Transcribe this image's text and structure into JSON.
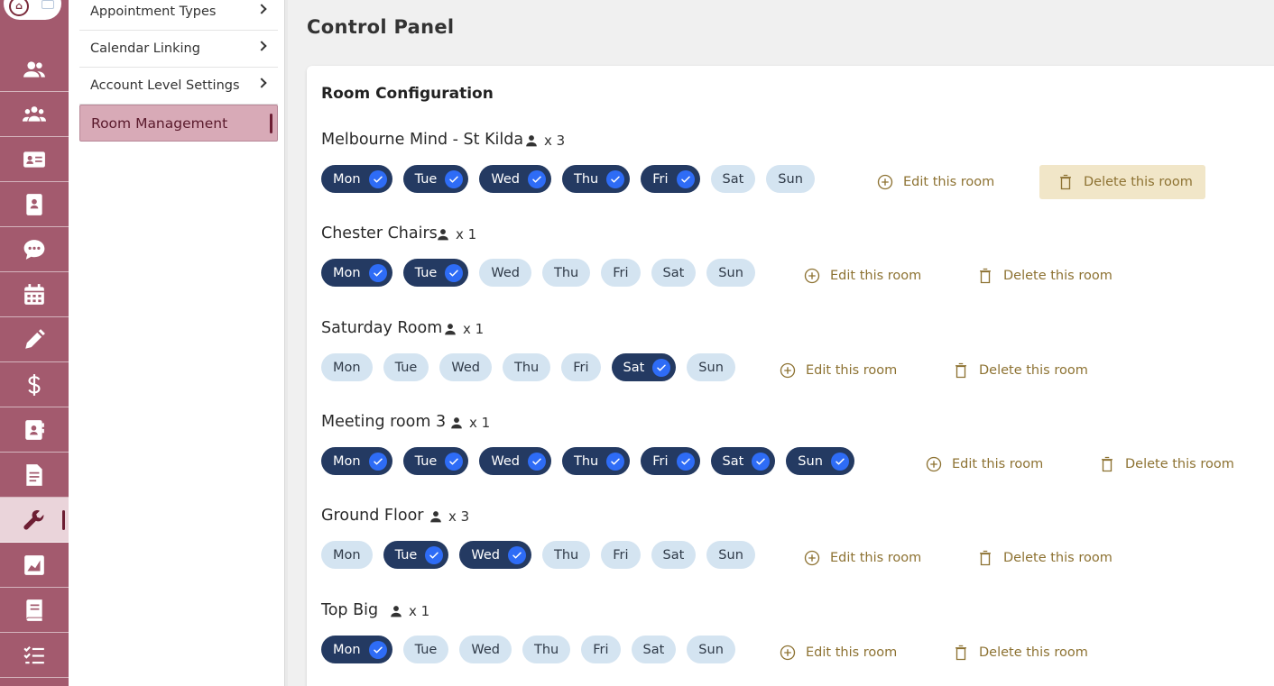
{
  "submenu": {
    "items": [
      {
        "label": "Appointment Types"
      },
      {
        "label": "Calendar Linking"
      },
      {
        "label": "Account Level Settings"
      },
      {
        "label": "Room Management"
      }
    ]
  },
  "rail": {
    "icons": [
      "person-icon",
      "group-icon",
      "id-card-icon",
      "contact-book-icon",
      "chat-icon",
      "calendar-icon",
      "pencil-icon",
      "dollar-icon",
      "address-book-icon",
      "document-icon",
      "wrench-icon",
      "chart-icon",
      "book-icon",
      "checklist-icon"
    ],
    "active": "wrench-icon"
  },
  "page": {
    "title": "Control Panel"
  },
  "room_config": {
    "title": "Room Configuration",
    "edit_label": "Edit this room",
    "delete_label": "Delete this room",
    "rooms": [
      {
        "name": "Melbourne Mind - St Kilda",
        "capacity": "x 3",
        "days": [
          {
            "label": "Mon",
            "on": true
          },
          {
            "label": "Tue",
            "on": true
          },
          {
            "label": "Wed",
            "on": true
          },
          {
            "label": "Thu",
            "on": true
          },
          {
            "label": "Fri",
            "on": true
          },
          {
            "label": "Sat",
            "on": false
          },
          {
            "label": "Sun",
            "on": false
          }
        ]
      },
      {
        "name": "Chester Chairs",
        "capacity": "x 1",
        "days": [
          {
            "label": "Mon",
            "on": true
          },
          {
            "label": "Tue",
            "on": true
          },
          {
            "label": "Wed",
            "on": false
          },
          {
            "label": "Thu",
            "on": false
          },
          {
            "label": "Fri",
            "on": false
          },
          {
            "label": "Sat",
            "on": false
          },
          {
            "label": "Sun",
            "on": false
          }
        ]
      },
      {
        "name": "Saturday Room",
        "capacity": "x 1",
        "days": [
          {
            "label": "Mon",
            "on": false
          },
          {
            "label": "Tue",
            "on": false
          },
          {
            "label": "Wed",
            "on": false
          },
          {
            "label": "Thu",
            "on": false
          },
          {
            "label": "Fri",
            "on": false
          },
          {
            "label": "Sat",
            "on": true
          },
          {
            "label": "Sun",
            "on": false
          }
        ]
      },
      {
        "name": "Meeting room 3",
        "capacity": "x 1",
        "days": [
          {
            "label": "Mon",
            "on": true
          },
          {
            "label": "Tue",
            "on": true
          },
          {
            "label": "Wed",
            "on": true
          },
          {
            "label": "Thu",
            "on": true
          },
          {
            "label": "Fri",
            "on": true
          },
          {
            "label": "Sat",
            "on": true
          },
          {
            "label": "Sun",
            "on": true
          }
        ]
      },
      {
        "name": "Ground Floor",
        "capacity": "x 3",
        "days": [
          {
            "label": "Mon",
            "on": false
          },
          {
            "label": "Tue",
            "on": true
          },
          {
            "label": "Wed",
            "on": true
          },
          {
            "label": "Thu",
            "on": false
          },
          {
            "label": "Fri",
            "on": false
          },
          {
            "label": "Sat",
            "on": false
          },
          {
            "label": "Sun",
            "on": false
          }
        ]
      },
      {
        "name": "Top Big",
        "capacity": "x 1",
        "days": [
          {
            "label": "Mon",
            "on": true
          },
          {
            "label": "Tue",
            "on": false
          },
          {
            "label": "Wed",
            "on": false
          },
          {
            "label": "Thu",
            "on": false
          },
          {
            "label": "Fri",
            "on": false
          },
          {
            "label": "Sat",
            "on": false
          },
          {
            "label": "Sun",
            "on": false
          }
        ]
      }
    ]
  },
  "colors": {
    "rail": "#a35a6e",
    "accent_dark": "#6d1e33",
    "day_on": "#243a62",
    "day_off": "#d4e4f1",
    "check": "#2e6cf6",
    "action_text": "#8d7232",
    "hover_bg": "#f1e6c8"
  }
}
